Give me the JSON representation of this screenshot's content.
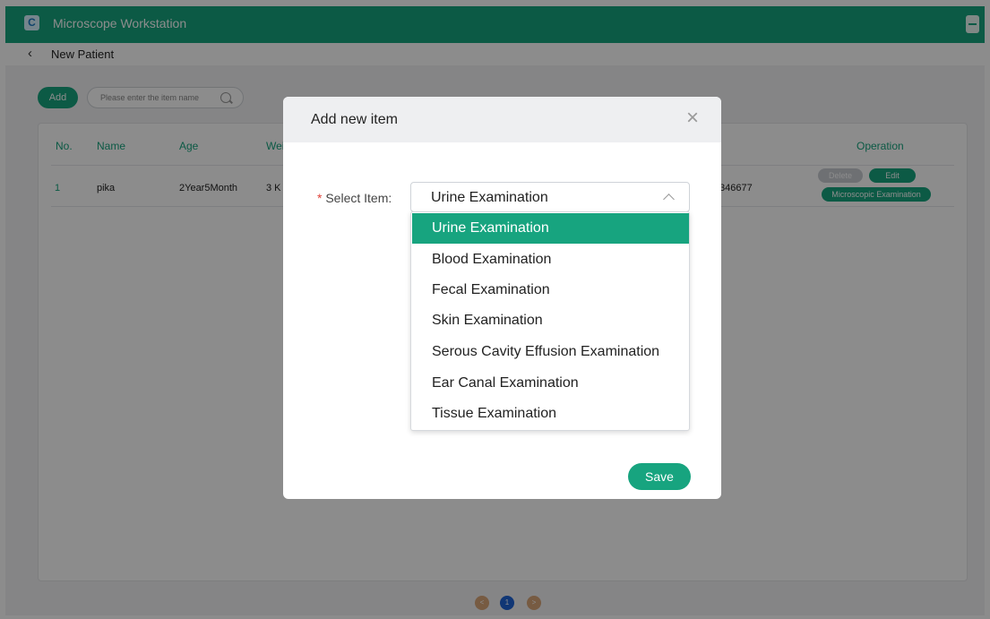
{
  "app": {
    "title": "Microscope Workstation",
    "logo_glyph": "C"
  },
  "subbar": {
    "back_glyph": "‹",
    "title": "New Patient"
  },
  "toolbar": {
    "add_label": "Add",
    "search_placeholder": "Please enter the item name"
  },
  "table": {
    "columns": [
      "No.",
      "Name",
      "Age",
      "Wei",
      "Operation"
    ],
    "rows": [
      {
        "no": "1",
        "name": "pika",
        "age": "2Year5Month",
        "weight": "3 K",
        "phone": "346677"
      }
    ],
    "ops": {
      "delete": "Delete",
      "edit": "Edit",
      "micro": "Microscopic Examination"
    }
  },
  "pager": {
    "prev": "<",
    "current": "1",
    "next": ">"
  },
  "dialog": {
    "title": "Add new item",
    "close_glyph": "×",
    "required_mark": "*",
    "field_label": "Select Item:",
    "selected_value": "Urine Examination",
    "options": [
      "Urine Examination",
      "Blood Examination",
      "Fecal Examination",
      "Skin Examination",
      "Serous Cavity Effusion Examination",
      "Ear Canal Examination",
      "Tissue Examination"
    ],
    "save_label": "Save"
  },
  "colors": {
    "accent": "#17a47f",
    "page_active": "#1e63d6",
    "page_arrow": "#d9a679",
    "required": "#e0433a"
  }
}
